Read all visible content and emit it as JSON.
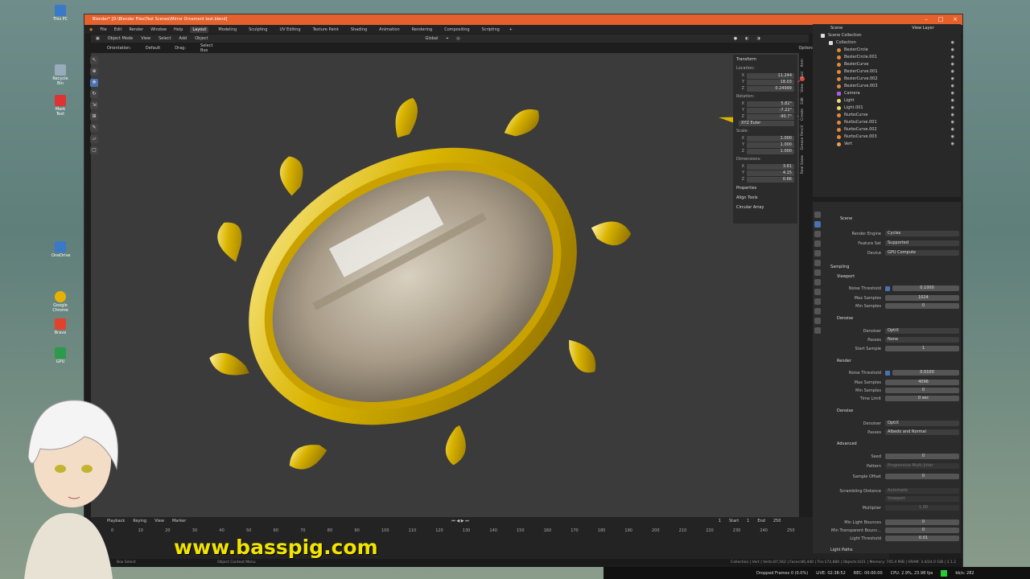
{
  "window": {
    "title": "Blender* [D:\\Blender Files\\Test Scenes\\Mirror Ornament test.blend]"
  },
  "desktop_icons": [
    "This PC",
    "Recycle Bin",
    "Mark Text",
    "OneDrive",
    "Google Chrome",
    "Brave",
    "GPU"
  ],
  "menu": {
    "items": [
      "File",
      "Edit",
      "Render",
      "Window",
      "Help"
    ],
    "workspaces": [
      "Layout",
      "Modeling",
      "Sculpting",
      "UV Editing",
      "Texture Paint",
      "Shading",
      "Animation",
      "Rendering",
      "Compositing",
      "Scripting"
    ],
    "active_workspace": "Layout"
  },
  "viewport_header": {
    "mode": "Object Mode",
    "menus": [
      "View",
      "Select",
      "Add",
      "Object"
    ],
    "transform": "Global",
    "orientation_label": "Orientation:",
    "orientation": "Default",
    "drag_label": "Drag:",
    "drag": "Select Box",
    "options": "Options"
  },
  "npanel": {
    "header": "Transform",
    "location_label": "Location:",
    "location": [
      {
        "k": "X",
        "v": "11.244"
      },
      {
        "k": "Y",
        "v": "18.03"
      },
      {
        "k": "Z",
        "v": "0.24999"
      }
    ],
    "rotation_label": "Rotation:",
    "rotation": [
      {
        "k": "X",
        "v": "5.82°"
      },
      {
        "k": "Y",
        "v": "-7.22°"
      },
      {
        "k": "Z",
        "v": "-90.7°"
      }
    ],
    "rotation_mode": "XYZ Euler",
    "scale_label": "Scale:",
    "scale": [
      {
        "k": "X",
        "v": "1.000"
      },
      {
        "k": "Y",
        "v": "1.000"
      },
      {
        "k": "Z",
        "v": "1.000"
      }
    ],
    "dimensions_label": "Dimensions:",
    "dimensions": [
      {
        "k": "X",
        "v": "3.61"
      },
      {
        "k": "Y",
        "v": "4.15"
      },
      {
        "k": "Z",
        "v": "0.66"
      }
    ],
    "sections": [
      "Properties",
      "Align Tools",
      "Circular Array"
    ]
  },
  "vertical_tabs": [
    "Item",
    "Tool",
    "View",
    "Edit",
    "Create",
    "Grease Pencil",
    "Real Snow",
    "Edit"
  ],
  "outliner": {
    "header": "Scene",
    "view_layer": "View Layer",
    "scene_collection": "Scene Collection",
    "collection": "Collection",
    "items": [
      {
        "name": "BezierCircle",
        "type": "curve"
      },
      {
        "name": "BezierCircle.001",
        "type": "curve"
      },
      {
        "name": "BezierCurve",
        "type": "curve"
      },
      {
        "name": "BezierCurve.001",
        "type": "curve"
      },
      {
        "name": "BezierCurve.002",
        "type": "curve"
      },
      {
        "name": "BezierCurve.003",
        "type": "curve"
      },
      {
        "name": "Camera",
        "type": "cam"
      },
      {
        "name": "Light",
        "type": "lig"
      },
      {
        "name": "Light.001",
        "type": "lig"
      },
      {
        "name": "NurbsCurve",
        "type": "curve"
      },
      {
        "name": "NurbsCurve.001",
        "type": "curve"
      },
      {
        "name": "NurbsCurve.002",
        "type": "curve"
      },
      {
        "name": "NurbsCurve.003",
        "type": "curve"
      },
      {
        "name": "Vert",
        "type": "mesh"
      }
    ]
  },
  "properties": {
    "header": "Scene",
    "render_engine_label": "Render Engine",
    "render_engine": "Cycles",
    "feature_set_label": "Feature Set",
    "feature_set": "Supported",
    "device_label": "Device",
    "device": "GPU Compute",
    "sampling": "Sampling",
    "viewport": "Viewport",
    "noise_threshold_label": "Noise Threshold",
    "vp_noise_threshold": "0.1000",
    "max_samples_label": "Max Samples",
    "vp_max_samples": "1024",
    "min_samples_label": "Min Samples",
    "vp_min_samples": "0",
    "denoise": "Denoise",
    "denoiser_label": "Denoiser",
    "vp_denoiser": "OptiX",
    "passes_label": "Passes",
    "vp_passes": "None",
    "start_sample_label": "Start Sample",
    "vp_start_sample": "1",
    "render": "Render",
    "r_noise_threshold": "0.0100",
    "r_max_samples": "4096",
    "r_min_samples": "0",
    "time_limit_label": "Time Limit",
    "r_time_limit": "0 sec",
    "r_denoiser": "OptiX",
    "r_passes": "Albedo and Normal",
    "advanced": "Advanced",
    "seed_label": "Seed",
    "seed": "0",
    "pattern_label": "Pattern",
    "pattern": "Progressive Multi-Jitter",
    "sample_offset_label": "Sample Offset",
    "sample_offset": "0",
    "scrambling_label": "Scrambling Distance",
    "automatic": "Automatic",
    "viewport_cb": "Viewport",
    "multiplier_label": "Multiplier",
    "multiplier": "1.00",
    "min_light_bounces_label": "Min Light Bounces",
    "min_light_bounces": "0",
    "min_transparent_label": "Min Transparent Bounc...",
    "min_transparent": "0",
    "light_threshold_label": "Light Threshold",
    "light_threshold": "0.01",
    "light_paths": "Light Paths"
  },
  "timeline": {
    "menus": [
      "Playback",
      "Keying",
      "View",
      "Marker"
    ],
    "current_frame": "1",
    "start_label": "Start",
    "start": "1",
    "end_label": "End",
    "end": "250",
    "ticks": [
      "0",
      "10",
      "20",
      "30",
      "40",
      "50",
      "60",
      "70",
      "80",
      "90",
      "100",
      "110",
      "120",
      "130",
      "140",
      "150",
      "160",
      "170",
      "180",
      "190",
      "200",
      "210",
      "220",
      "230",
      "240",
      "250"
    ]
  },
  "status": {
    "left": "Box Select",
    "middle": "Object Context Menu",
    "right": "Collection | Vert | Verts:87,562 | Faces:86,440 | Tris:172,880 | Objects:0/21 | Memory: 745.4 MiB | VRAM: 3.4/24.0 GiB | 3.1.2"
  },
  "obs": {
    "dropped": "Dropped Frames 0 (0.0%)",
    "live": "LIVE: 02:38:52",
    "rec": "REC: 00:00:00",
    "cpu": "CPU: 2.9%, 23.98 fps",
    "kbps": "kb/s: 282"
  },
  "watermark": "www.basspig.com",
  "colors": {
    "title_bar": "#e4612e",
    "accent": "#4a72b0",
    "gold": "#d9b400",
    "watermark": "#f1e400"
  }
}
